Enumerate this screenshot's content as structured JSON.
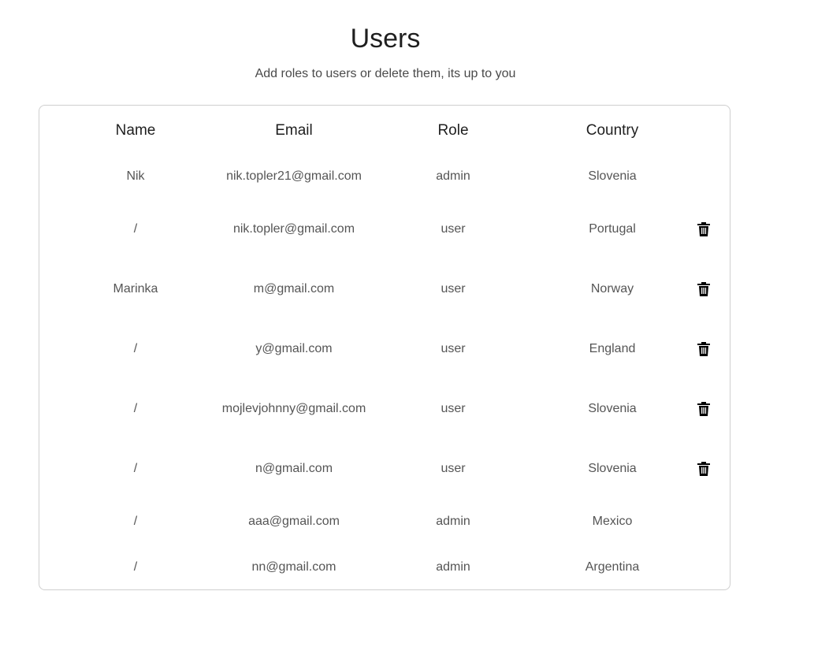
{
  "page": {
    "title": "Users",
    "subtitle": "Add roles to users or delete them, its up to you"
  },
  "table": {
    "columns": [
      "Name",
      "Email",
      "Role",
      "Country"
    ],
    "rows": [
      {
        "name": "Nik",
        "email": "nik.topler21@gmail.com",
        "role": "admin",
        "country": "Slovenia",
        "deletable": false
      },
      {
        "name": "/",
        "email": "nik.topler@gmail.com",
        "role": "user",
        "country": "Portugal",
        "deletable": true
      },
      {
        "name": "Marinka",
        "email": "m@gmail.com",
        "role": "user",
        "country": "Norway",
        "deletable": true
      },
      {
        "name": "/",
        "email": "y@gmail.com",
        "role": "user",
        "country": "England",
        "deletable": true
      },
      {
        "name": "/",
        "email": "mojlevjohnny@gmail.com",
        "role": "user",
        "country": "Slovenia",
        "deletable": true
      },
      {
        "name": "/",
        "email": "n@gmail.com",
        "role": "user",
        "country": "Slovenia",
        "deletable": true
      },
      {
        "name": "/",
        "email": "aaa@gmail.com",
        "role": "admin",
        "country": "Mexico",
        "deletable": false
      },
      {
        "name": "/",
        "email": "nn@gmail.com",
        "role": "admin",
        "country": "Argentina",
        "deletable": false
      }
    ]
  },
  "icons": {
    "delete": "trash-icon"
  }
}
